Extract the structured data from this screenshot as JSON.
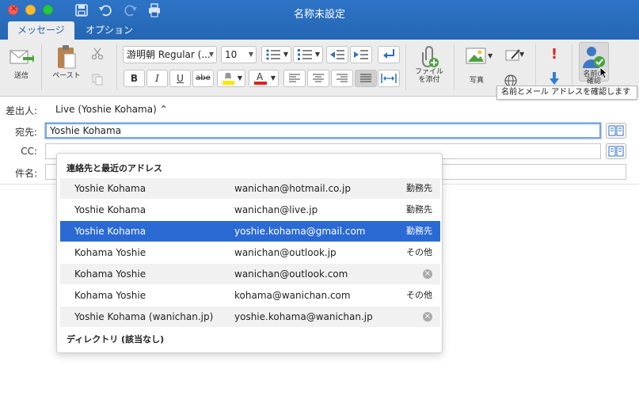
{
  "window": {
    "title": "名称未設定"
  },
  "tabs": [
    {
      "label": "メッセージ",
      "active": true
    },
    {
      "label": "オプション",
      "active": false
    }
  ],
  "ribbon": {
    "send_label": "送信",
    "paste_label": "ペースト",
    "font_name": "游明朝 Regular (...",
    "font_size": "10",
    "attach_label": "ファイル\nを添付",
    "picture_label": "写真",
    "checknames_label": "名前の\n確認",
    "tooltip": "名前とメール アドレスを確認します",
    "accent_color": "#2466b4",
    "highlight_color": "#ffe600",
    "font_color": "#e02020"
  },
  "compose": {
    "from_label": "差出人:",
    "from_value": "Live (Yoshie Kohama) ⌃",
    "to_label": "宛先:",
    "to_value": "Yoshie Kohama",
    "cc_label": "CC:",
    "cc_value": "",
    "subject_label": "件名:",
    "subject_value": ""
  },
  "autocomplete": {
    "header": "連絡先と最近のアドレス",
    "rows": [
      {
        "name": "Yoshie Kohama",
        "email": "wanichan@hotmail.co.jp",
        "tag": "勤務先",
        "removable": false
      },
      {
        "name": "Yoshie Kohama",
        "email": "wanichan@live.jp",
        "tag": "勤務先",
        "removable": false
      },
      {
        "name": "Yoshie Kohama",
        "email": "yoshie.kohama@gmail.com",
        "tag": "勤務先",
        "removable": false
      },
      {
        "name": "Kohama Yoshie",
        "email": "wanichan@outlook.jp",
        "tag": "その他",
        "removable": false
      },
      {
        "name": "Kohama Yoshie",
        "email": "wanichan@outlook.com",
        "tag": "",
        "removable": true
      },
      {
        "name": "Kohama Yoshie",
        "email": "kohama@wanichan.com",
        "tag": "その他",
        "removable": false
      },
      {
        "name": "Yoshie Kohama (wanichan.jp)",
        "email": "yoshie.kohama@wanichan.jp",
        "tag": "",
        "removable": true
      }
    ],
    "selected_index": 2,
    "footer": "ディレクトリ (該当なし)",
    "selection_color": "#2b6ad4"
  }
}
